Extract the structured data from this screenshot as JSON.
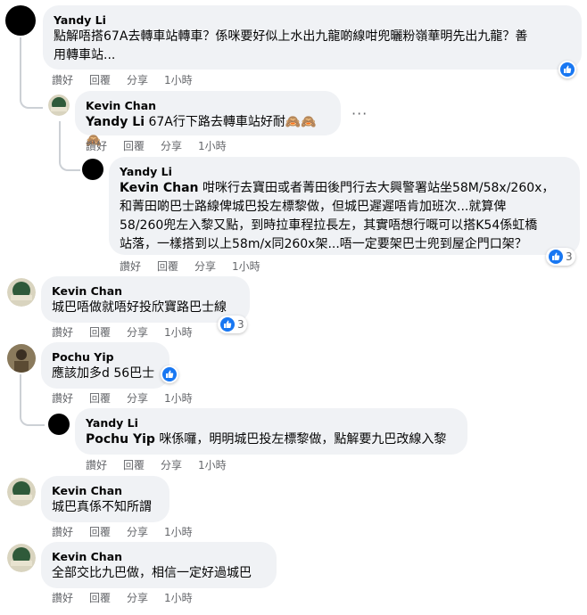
{
  "comments": [
    {
      "name": "Yandy Li",
      "text_line1": "點解唔搭67A去轉車站轉車？係咪要好似上水出九龍啲線咁兜曬粉嶺華明先出九龍？善",
      "text_line2": "用轉車站...",
      "actions": {
        "like": "讚好",
        "reply": "回覆",
        "share": "分享",
        "time": "1小時"
      },
      "reaction_icon": "like-icon"
    },
    {
      "name": "Kevin Chan",
      "mention": "Yandy Li",
      "text": " 67A行下路去轉車站好耐🙈🙈🙈",
      "actions": {
        "like": "讚好",
        "reply": "回覆",
        "share": "分享",
        "time": "1小時"
      },
      "more": "···"
    },
    {
      "name": "Yandy Li",
      "mention": "Kevin Chan",
      "text_line1": " 咁咪行去寶田或者菁田後門行去大興警署站坐58M/58x/260x，",
      "text_line2": "和菁田啲巴士路線俾城巴投左標黎做，但城巴遲遲唔肯加班次...就算俾",
      "text_line3": "58/260兜左入黎又點，到時拉車程拉長左，其實唔想行嘅可以搭K54係虹橋",
      "text_line4": "站落，一樣搭到以上58m/x同260x架...唔一定要架巴士兜到屋企門口架？",
      "actions": {
        "like": "讚好",
        "reply": "回覆",
        "share": "分享",
        "time": "1小時"
      },
      "reaction_count": "3"
    },
    {
      "name": "Kevin Chan",
      "text": "城巴唔做就唔好投欣寶路巴士線",
      "actions": {
        "like": "讚好",
        "reply": "回覆",
        "share": "分享",
        "time": "1小時"
      },
      "reaction_count": "3"
    },
    {
      "name": "Pochu Yip",
      "text": "應該加多d 56巴士",
      "actions": {
        "like": "讚好",
        "reply": "回覆",
        "share": "分享",
        "time": "1小時"
      }
    },
    {
      "name": "Yandy Li",
      "mention": "Pochu Yip",
      "text": " 咪係囉，明明城巴投左標黎做，點解要九巴改線入黎",
      "actions": {
        "like": "讚好",
        "reply": "回覆",
        "share": "分享",
        "time": "1小時"
      }
    },
    {
      "name": "Kevin Chan",
      "text": "城巴真係不知所謂",
      "actions": {
        "like": "讚好",
        "reply": "回覆",
        "share": "分享",
        "time": "1小時"
      }
    },
    {
      "name": "Kevin Chan",
      "text": "全部交比九巴做，相信一定好過城巴",
      "actions": {
        "like": "讚好",
        "reply": "回覆",
        "share": "分享",
        "time": "1小時"
      }
    }
  ],
  "colors": {
    "bubble": "#f0f2f5",
    "like_blue": "#1877f2",
    "meta_gray": "#65676b"
  }
}
